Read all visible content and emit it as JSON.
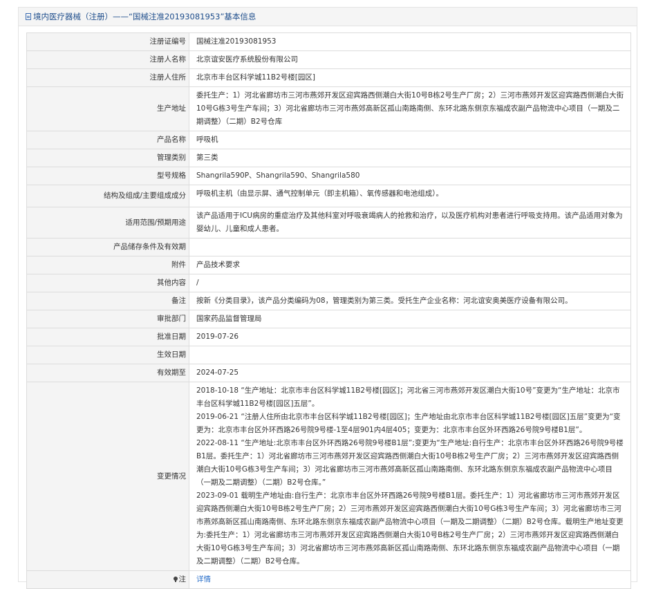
{
  "header": {
    "title": "境内医疗器械（注册）——“国械注准20193081953”基本信息"
  },
  "rows": [
    {
      "label": "注册证编号",
      "value": "国械注准20193081953"
    },
    {
      "label": "注册人名称",
      "value": "北京谊安医疗系统股份有限公司"
    },
    {
      "label": "注册人住所",
      "value": "北京市丰台区科学城11B2号楼[园区]"
    },
    {
      "label": "生产地址",
      "value": "委托生产：1）河北省廊坊市三河市燕郊开发区迎宾路西侧潮白大街10号B栋2号生产厂房；2）三河市燕郊开发区迎宾路西侧潮白大街10号G栋3号生产车间；3）河北省廊坊市三河市燕郊高新区孤山南路南侧、东环北路东侧京东福成农副产品物流中心项目（一期及二期调整）（二期）B2号仓库"
    },
    {
      "label": "产品名称",
      "value": "呼吸机"
    },
    {
      "label": "管理类别",
      "value": "第三类"
    },
    {
      "label": "型号规格",
      "value": "Shangrila590P、Shangrila590、Shangrila580"
    },
    {
      "label": "结构及组成/主要组成成分",
      "value": "呼吸机主机（由显示屏、通气控制单元（即主机箱）、氧传感器和电池组成）。"
    },
    {
      "label": "适用范围/预期用途",
      "value": "该产品适用于ICU病房的重症治疗及其他科室对呼吸衰竭病人的抢救和治疗，以及医疗机构对患者进行呼吸支持用。该产品适用对象为婴幼儿、儿童和成人患者。"
    },
    {
      "label": "产品储存条件及有效期",
      "value": ""
    },
    {
      "label": "附件",
      "value": "产品技术要求"
    },
    {
      "label": "其他内容",
      "value": "/"
    },
    {
      "label": "备注",
      "value": "按新《分类目录》，该产品分类编码为08，管理类别为第三类。受托生产企业名称：河北谊安奥美医疗设备有限公司。"
    },
    {
      "label": "审批部门",
      "value": "国家药品监督管理局"
    },
    {
      "label": "批准日期",
      "value": "2019-07-26"
    },
    {
      "label": "生效日期",
      "value": ""
    },
    {
      "label": "有效期至",
      "value": "2024-07-25"
    }
  ],
  "changes": {
    "label": "变更情况",
    "entries": [
      "2018-10-18 “生产地址：北京市丰台区科学城11B2号楼[园区]；河北省三河市燕郊开发区潮白大街10号”变更为“生产地址：北京市丰台区科学城11B2号楼[园区]五层”。",
      "2019-06-21 “注册人住所由北京市丰台区科学城11B2号楼[园区]；生产地址由北京市丰台区科学城11B2号楼[园区]五层”变更为“变更为：北京市丰台区外环西路26号院9号楼-1至4层901内4层405；变更为：北京市丰台区外环西路26号院9号楼B1层”。",
      "2022-08-11 “生产地址:北京市丰台区外环西路26号院9号楼B1层”;变更为“生产地址:自行生产：北京市丰台区外环西路26号院9号楼B1层。委托生产：1）河北省廊坊市三河市燕郊开发区迎宾路西侧潮白大街10号B栋2号生产厂房；2）三河市燕郊开发区迎宾路西侧潮白大街10号G栋3号生产车间；3）河北省廊坊市三河市燕郊高新区孤山南路南侧、东环北路东侧京东福成农副产品物流中心项目（一期及二期调整）（二期）B2号仓库。”",
      "2023-09-01 载明生产地址由:自行生产：北京市丰台区外环西路26号院9号楼B1层。委托生产：1）河北省廊坊市三河市燕郊开发区迎宾路西侧潮白大街10号B栋2号生产厂房；2）三河市燕郊开发区迎宾路西侧潮白大街10号G栋3号生产车间；3）河北省廊坊市三河市燕郊高新区孤山南路南侧、东环北路东侧京东福成农副产品物流中心项目（一期及二期调整）（二期）B2号仓库。载明生产地址变更为:委托生产：1）河北省廊坊市三河市燕郊开发区迎宾路西侧潮白大街10号B栋2号生产厂房；2）三河市燕郊开发区迎宾路西侧潮白大街10号G栋3号生产车间；3）河北省廊坊市三河市燕郊高新区孤山南路南侧、东环北路东侧京东福成农副产品物流中心项目（一期及二期调整）（二期）B2号仓库。"
    ]
  },
  "note": {
    "label": "注",
    "link": "详情"
  }
}
